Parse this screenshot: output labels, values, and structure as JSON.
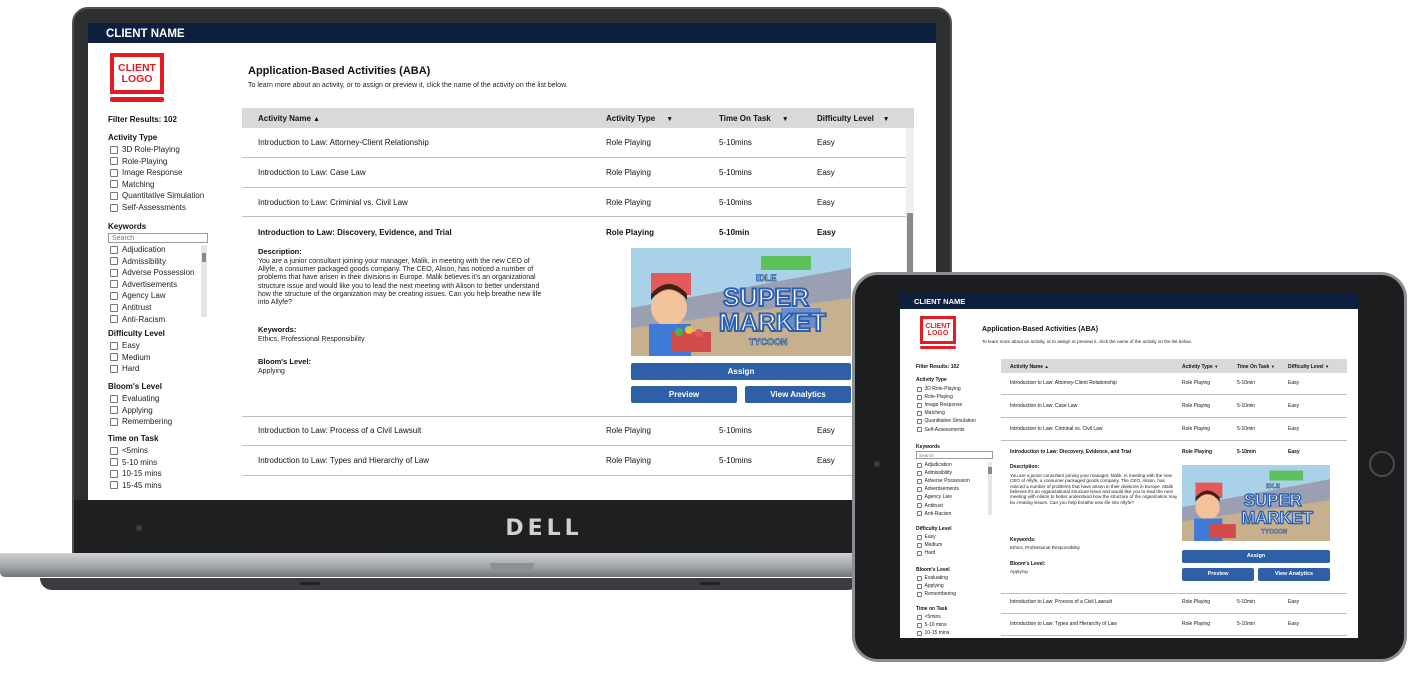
{
  "app": {
    "client_name": "CLIENT NAME",
    "logo_line1": "CLIENT",
    "logo_line2": "LOGO",
    "title": "Application-Based Activities (ABA)",
    "subtitle": "To learn more about an activity, or to assign or preview it, click the name of the activity on the list below."
  },
  "filters": {
    "results": "Filter Results: 102",
    "activity_type": {
      "title": "Activity Type",
      "options": [
        "3D Role-Playing",
        "Role-Playing",
        "Image Response",
        "Matching",
        "Quantitative Simulation",
        "Self-Assessments"
      ]
    },
    "keywords": {
      "title": "Keywords",
      "placeholder": "Search",
      "options": [
        "Adjudication",
        "Admissibility",
        "Adverse Possession",
        "Advertisements",
        "Agency Law",
        "Antitrust",
        "Anti-Racism"
      ]
    },
    "difficulty": {
      "title": "Difficulty Level",
      "options": [
        "Easy",
        "Medium",
        "Hard"
      ]
    },
    "blooms": {
      "title": "Bloom's Level",
      "options": [
        "Evaluating",
        "Applying",
        "Remembering"
      ]
    },
    "time": {
      "title": "Time on Task",
      "options": [
        "<5mins",
        "5-10 mins",
        "10-15 mins",
        "15-45 mins"
      ]
    }
  },
  "table": {
    "headers": {
      "name": "Activity Name",
      "type": "Activity Type",
      "time": "Time On Task",
      "difficulty": "Difficulty Level",
      "sort_asc": "▲",
      "sort_desc": "▼"
    },
    "rows": [
      {
        "name": "Introduction to Law: Attorney-Client Relationship",
        "type": "Role Playing",
        "time": "5-10mins",
        "difficulty": "Easy"
      },
      {
        "name": "Introduction to Law: Case Law",
        "type": "Role Playing",
        "time": "5-10mins",
        "difficulty": "Easy"
      },
      {
        "name": "Introduction to Law: Criminal vs. Civil Law",
        "type": "Role Playing",
        "time": "5-10mins",
        "difficulty": "Easy"
      },
      {
        "name": "Introduction to Law: Discovery, Evidence, and Trial",
        "type": "Role Playing",
        "time": "5-10min",
        "difficulty": "Easy"
      },
      {
        "name": "Introduction to Law: Process of a Civil Lawsuit",
        "type": "Role Playing",
        "time": "5-10mins",
        "difficulty": "Easy"
      },
      {
        "name": "Introduction to Law: Types and Hierarchy of Law",
        "type": "Role Playing",
        "time": "5-10mins",
        "difficulty": "Easy"
      }
    ],
    "tablet_rows": [
      {
        "name": "Introduction to Law: Attorney-Client Relationship",
        "type": "Role Playing",
        "time": "5-10min",
        "difficulty": "Easy"
      },
      {
        "name": "Introduction to Law: Case Law",
        "type": "Role Playing",
        "time": "5-10min",
        "difficulty": "Easy"
      },
      {
        "name": "Introduction to Law: Criminal vs. Civil Law",
        "type": "Role Playing",
        "time": "5-10min",
        "difficulty": "Easy"
      },
      {
        "name": "Introduction to Law: Discovery, Evidence, and Trial",
        "type": "Role Playing",
        "time": "5-10min",
        "difficulty": "Easy"
      },
      {
        "name": "Introduction to Law: Process of a Civil Lawsuit",
        "type": "Role Playing",
        "time": "5-10min",
        "difficulty": "Easy"
      },
      {
        "name": "Introduction to Law: Types and Hierarchy of Law",
        "type": "Role Playing",
        "time": "5-10min",
        "difficulty": "Easy"
      }
    ],
    "laptop_row3_name": "Introduction to Law: Criminial vs. Civil Law",
    "tablet_row3_name": "Introduction to Law: Criminal vs. Civil Law",
    "tablet_time_header": "Time On Task"
  },
  "expanded": {
    "description_label": "Description:",
    "description": "You are a junior consultant joining your manager, Malik, in meeting with the new CEO of Allyfe, a consumer packaged goods company. The CEO, Alison, has noticed a number of problems that have arisen in their divisions in Europe. Malik believes it's an organizational structure issue and would like you to lead the next meeting with Alison to better understand how the structure of the organization may be creating issues. Can you help breathe new life into Allyfe?",
    "keywords_label": "Keywords:",
    "keywords": "Ethics, Professional Responsibility",
    "blooms_label": "Bloom's Level:",
    "blooms": "Applying",
    "game_line1": "IDLE",
    "game_line2": "SUPER",
    "game_line3": "MARKET",
    "game_line4": "TYCOON",
    "assign": "Assign",
    "preview": "Preview",
    "analytics": "View Analytics"
  },
  "device": {
    "brand": "DELL"
  },
  "colors": {
    "header": "#0d1f3f",
    "accent": "#2f5fa6",
    "logo": "#e31b23",
    "table_header": "#d9d9d9"
  }
}
